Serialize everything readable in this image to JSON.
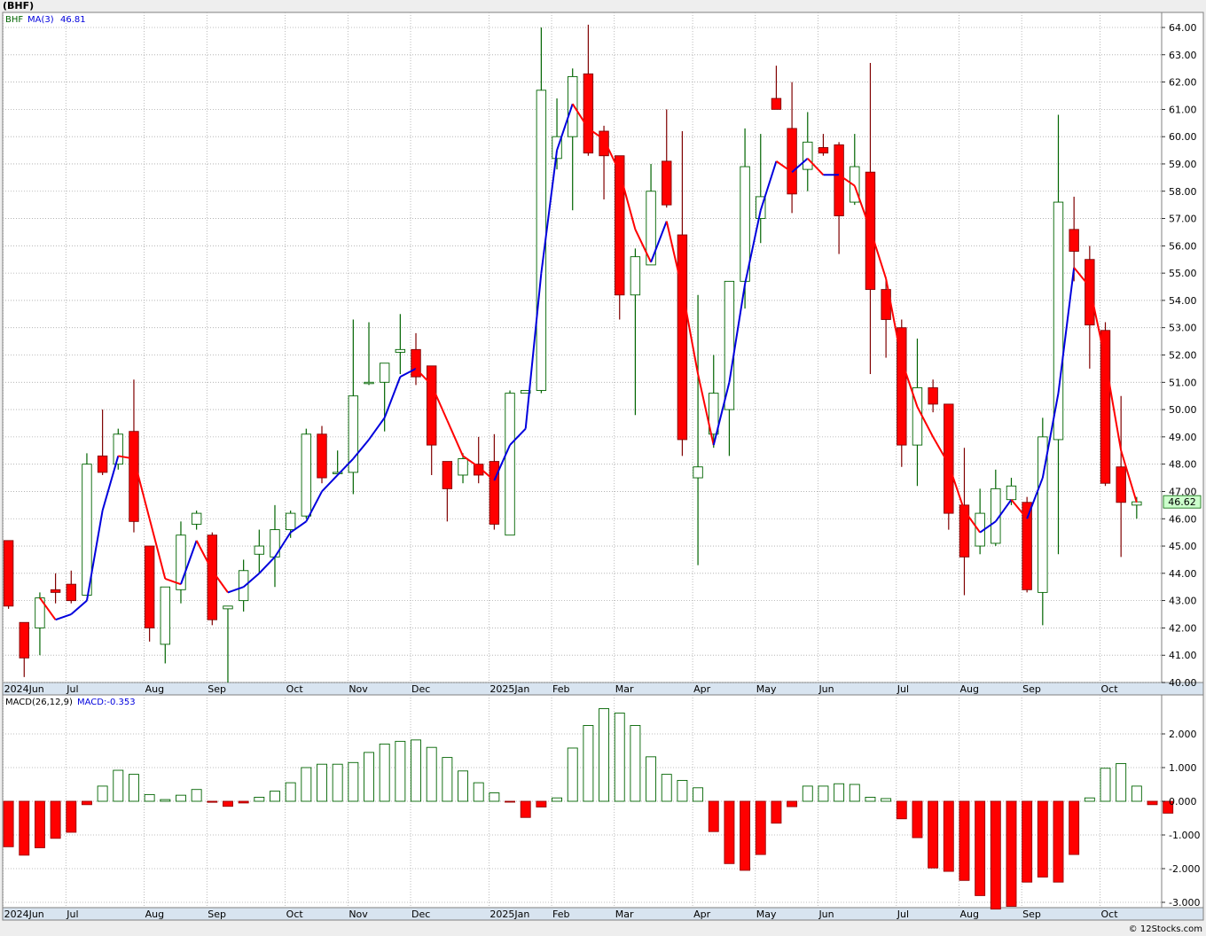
{
  "header": {
    "title": "(BHF)",
    "credit": "© 12Stocks.com"
  },
  "price_legend": {
    "symbol": "BHF",
    "ma_label": "MA(3)",
    "ma_value": "46.81"
  },
  "macd_legend": {
    "label": "MACD(26,12,9)",
    "value_label": "MACD:-0.353"
  },
  "last_price_tag": "46.62",
  "colors": {
    "up": "#006400",
    "down_fill": "#ff0000",
    "ma_up": "#0000dd",
    "ma_down": "#ff0000",
    "grid": "#aaaaaa",
    "tag_bg": "#ccffcc"
  },
  "chart_data": [
    {
      "type": "candlestick",
      "symbol": "BHF",
      "interval": "weekly",
      "ylim": [
        40,
        64
      ],
      "y_ticks": [
        "40.00",
        "41.00",
        "42.00",
        "43.00",
        "44.00",
        "45.00",
        "46.00",
        "47.00",
        "48.00",
        "49.00",
        "50.00",
        "51.00",
        "52.00",
        "53.00",
        "54.00",
        "55.00",
        "56.00",
        "57.00",
        "58.00",
        "59.00",
        "60.00",
        "61.00",
        "62.00",
        "63.00",
        "64.00"
      ],
      "x_labels": [
        {
          "label": "2024Jun",
          "week": 0
        },
        {
          "label": "Jul",
          "week": 4
        },
        {
          "label": "Aug",
          "week": 9
        },
        {
          "label": "Sep",
          "week": 13
        },
        {
          "label": "Oct",
          "week": 18
        },
        {
          "label": "Nov",
          "week": 22
        },
        {
          "label": "Dec",
          "week": 26
        },
        {
          "label": "2025Jan",
          "week": 31
        },
        {
          "label": "Feb",
          "week": 35
        },
        {
          "label": "Mar",
          "week": 39
        },
        {
          "label": "Apr",
          "week": 44
        },
        {
          "label": "May",
          "week": 48
        },
        {
          "label": "Jun",
          "week": 52
        },
        {
          "label": "Jul",
          "week": 57
        },
        {
          "label": "Aug",
          "week": 61
        },
        {
          "label": "Sep",
          "week": 65
        },
        {
          "label": "Oct",
          "week": 70
        }
      ],
      "candles": [
        {
          "o": 45.2,
          "h": 45.2,
          "l": 42.7,
          "c": 42.8
        },
        {
          "o": 42.2,
          "h": 42.2,
          "l": 40.2,
          "c": 40.9
        },
        {
          "o": 42.0,
          "h": 43.3,
          "l": 41.0,
          "c": 43.1
        },
        {
          "o": 43.4,
          "h": 44.0,
          "l": 42.9,
          "c": 43.3
        },
        {
          "o": 43.6,
          "h": 44.1,
          "l": 42.9,
          "c": 43.0
        },
        {
          "o": 43.2,
          "h": 48.4,
          "l": 43.2,
          "c": 48.0
        },
        {
          "o": 48.3,
          "h": 50.0,
          "l": 47.6,
          "c": 47.7
        },
        {
          "o": 48.0,
          "h": 49.3,
          "l": 47.8,
          "c": 49.1
        },
        {
          "o": 49.2,
          "h": 51.1,
          "l": 45.5,
          "c": 45.9
        },
        {
          "o": 45.0,
          "h": 45.0,
          "l": 41.5,
          "c": 42.0
        },
        {
          "o": 41.4,
          "h": 43.4,
          "l": 40.7,
          "c": 43.5
        },
        {
          "o": 43.4,
          "h": 45.9,
          "l": 42.9,
          "c": 45.4
        },
        {
          "o": 45.8,
          "h": 46.3,
          "l": 45.6,
          "c": 46.2
        },
        {
          "o": 45.4,
          "h": 45.5,
          "l": 42.1,
          "c": 42.3
        },
        {
          "o": 42.7,
          "h": 42.8,
          "l": 40.0,
          "c": 42.8
        },
        {
          "o": 43.0,
          "h": 44.5,
          "l": 42.6,
          "c": 44.1
        },
        {
          "o": 44.7,
          "h": 45.6,
          "l": 44.0,
          "c": 45.0
        },
        {
          "o": 44.6,
          "h": 46.5,
          "l": 43.5,
          "c": 45.6
        },
        {
          "o": 45.6,
          "h": 46.3,
          "l": 45.3,
          "c": 46.2
        },
        {
          "o": 46.1,
          "h": 49.3,
          "l": 46.0,
          "c": 49.1
        },
        {
          "o": 49.1,
          "h": 49.4,
          "l": 47.3,
          "c": 47.5
        },
        {
          "o": 47.7,
          "h": 48.5,
          "l": 47.7,
          "c": 47.7
        },
        {
          "o": 47.7,
          "h": 53.3,
          "l": 46.9,
          "c": 50.5
        },
        {
          "o": 51.0,
          "h": 53.2,
          "l": 50.9,
          "c": 51.0
        },
        {
          "o": 51.0,
          "h": 51.6,
          "l": 49.2,
          "c": 51.7
        },
        {
          "o": 52.1,
          "h": 53.5,
          "l": 51.3,
          "c": 52.2
        },
        {
          "o": 52.2,
          "h": 52.8,
          "l": 50.9,
          "c": 51.2
        },
        {
          "o": 51.6,
          "h": 51.6,
          "l": 47.6,
          "c": 48.7
        },
        {
          "o": 48.1,
          "h": 48.1,
          "l": 45.9,
          "c": 47.1
        },
        {
          "o": 47.6,
          "h": 48.4,
          "l": 47.3,
          "c": 48.2
        },
        {
          "o": 48.0,
          "h": 49.0,
          "l": 47.3,
          "c": 47.6
        },
        {
          "o": 48.1,
          "h": 49.1,
          "l": 45.6,
          "c": 45.8
        },
        {
          "o": 45.4,
          "h": 50.7,
          "l": 45.4,
          "c": 50.6
        },
        {
          "o": 50.6,
          "h": 50.7,
          "l": 50.6,
          "c": 50.7
        },
        {
          "o": 50.7,
          "h": 64.0,
          "l": 50.6,
          "c": 61.7
        },
        {
          "o": 59.2,
          "h": 61.4,
          "l": 58.8,
          "c": 60.0
        },
        {
          "o": 60.0,
          "h": 62.5,
          "l": 57.3,
          "c": 62.2
        },
        {
          "o": 62.3,
          "h": 64.1,
          "l": 59.3,
          "c": 59.4
        },
        {
          "o": 60.2,
          "h": 60.4,
          "l": 57.7,
          "c": 59.3
        },
        {
          "o": 59.3,
          "h": 59.3,
          "l": 53.3,
          "c": 54.2
        },
        {
          "o": 54.2,
          "h": 55.9,
          "l": 49.8,
          "c": 55.6
        },
        {
          "o": 55.3,
          "h": 59.0,
          "l": 55.3,
          "c": 58.0
        },
        {
          "o": 59.1,
          "h": 61.0,
          "l": 57.4,
          "c": 57.5
        },
        {
          "o": 56.4,
          "h": 60.2,
          "l": 48.3,
          "c": 48.9
        },
        {
          "o": 47.5,
          "h": 54.2,
          "l": 44.3,
          "c": 47.9
        },
        {
          "o": 49.1,
          "h": 52.0,
          "l": 48.6,
          "c": 50.6
        },
        {
          "o": 50.0,
          "h": 54.7,
          "l": 48.3,
          "c": 54.7
        },
        {
          "o": 54.7,
          "h": 60.3,
          "l": 53.7,
          "c": 58.9
        },
        {
          "o": 57.0,
          "h": 60.1,
          "l": 56.1,
          "c": 57.8
        },
        {
          "o": 61.4,
          "h": 62.6,
          "l": 61.0,
          "c": 61.0
        },
        {
          "o": 60.3,
          "h": 62.0,
          "l": 57.2,
          "c": 57.9
        },
        {
          "o": 58.8,
          "h": 60.9,
          "l": 58.0,
          "c": 59.8
        },
        {
          "o": 59.6,
          "h": 60.1,
          "l": 59.3,
          "c": 59.4
        },
        {
          "o": 59.7,
          "h": 59.8,
          "l": 55.7,
          "c": 57.1
        },
        {
          "o": 57.6,
          "h": 60.1,
          "l": 57.5,
          "c": 58.9
        },
        {
          "o": 58.7,
          "h": 62.7,
          "l": 51.3,
          "c": 54.4
        },
        {
          "o": 54.4,
          "h": 54.8,
          "l": 51.9,
          "c": 53.3
        },
        {
          "o": 53.0,
          "h": 53.3,
          "l": 47.9,
          "c": 48.7
        },
        {
          "o": 48.7,
          "h": 52.6,
          "l": 47.2,
          "c": 50.8
        },
        {
          "o": 50.8,
          "h": 51.1,
          "l": 49.9,
          "c": 50.2
        },
        {
          "o": 50.2,
          "h": 50.2,
          "l": 45.6,
          "c": 46.2
        },
        {
          "o": 46.5,
          "h": 48.6,
          "l": 43.2,
          "c": 44.6
        },
        {
          "o": 45.0,
          "h": 47.1,
          "l": 44.7,
          "c": 46.2
        },
        {
          "o": 45.1,
          "h": 47.8,
          "l": 45.0,
          "c": 47.1
        },
        {
          "o": 46.7,
          "h": 47.5,
          "l": 46.5,
          "c": 47.2
        },
        {
          "o": 46.6,
          "h": 46.8,
          "l": 43.3,
          "c": 43.4
        },
        {
          "o": 43.3,
          "h": 49.7,
          "l": 42.1,
          "c": 49.0
        },
        {
          "o": 48.9,
          "h": 60.8,
          "l": 44.7,
          "c": 57.6
        },
        {
          "o": 56.6,
          "h": 57.8,
          "l": 54.7,
          "c": 55.8
        },
        {
          "o": 55.5,
          "h": 56.0,
          "l": 51.5,
          "c": 53.1
        },
        {
          "o": 52.9,
          "h": 53.2,
          "l": 47.2,
          "c": 47.3
        },
        {
          "o": 47.9,
          "h": 50.5,
          "l": 44.6,
          "c": 46.6
        },
        {
          "o": 46.5,
          "h": 46.8,
          "l": 46.0,
          "c": 46.62
        }
      ],
      "ma3": [
        null,
        null,
        43.1,
        42.3,
        42.5,
        43.0,
        46.3,
        48.3,
        48.2,
        46.0,
        43.8,
        43.6,
        45.2,
        44.1,
        43.3,
        43.5,
        44.0,
        44.6,
        45.5,
        45.9,
        47.0,
        47.6,
        48.2,
        48.9,
        49.7,
        51.2,
        51.5,
        50.9,
        49.6,
        48.3,
        47.9,
        47.4,
        48.7,
        49.3,
        55.0,
        59.5,
        61.2,
        60.3,
        59.9,
        58.7,
        56.6,
        55.4,
        56.9,
        54.4,
        51.3,
        48.7,
        51.0,
        54.6,
        57.3,
        59.1,
        58.7,
        59.2,
        58.6,
        58.6,
        58.2,
        56.6,
        54.8,
        51.8,
        50.1,
        49.0,
        48.0,
        46.3,
        45.5,
        45.9,
        46.7,
        46.0,
        47.5,
        50.6,
        55.2,
        54.5,
        51.8,
        48.5,
        46.6
      ]
    },
    {
      "type": "bar",
      "title": "MACD(26,12,9)",
      "indicator": "MACD",
      "last_value": -0.353,
      "ylim": [
        -3.3,
        2.9
      ],
      "y_ticks": [
        "-3.000",
        "-2.000",
        "-1.000",
        "0.000",
        "1.000",
        "2.000"
      ],
      "values": [
        -1.35,
        -1.6,
        -1.38,
        -1.1,
        -0.92,
        -0.1,
        0.45,
        0.92,
        0.8,
        0.2,
        0.05,
        0.18,
        0.35,
        -0.03,
        -0.15,
        -0.05,
        0.12,
        0.3,
        0.55,
        1.0,
        1.1,
        1.1,
        1.15,
        1.45,
        1.7,
        1.78,
        1.82,
        1.6,
        1.3,
        0.9,
        0.55,
        0.25,
        -0.02,
        -0.48,
        -0.17,
        0.1,
        1.58,
        2.25,
        2.75,
        2.62,
        2.25,
        1.32,
        0.8,
        0.62,
        0.4,
        -0.9,
        -1.85,
        -2.05,
        -1.58,
        -0.65,
        -0.16,
        0.45,
        0.45,
        0.52,
        0.5,
        0.12,
        0.08,
        -0.52,
        -1.08,
        -1.98,
        -2.08,
        -2.35,
        -2.8,
        -3.2,
        -3.12,
        -2.4,
        -2.25,
        -2.4,
        -1.58,
        0.1,
        0.98,
        1.12,
        0.45,
        -0.1,
        -0.353
      ]
    }
  ]
}
